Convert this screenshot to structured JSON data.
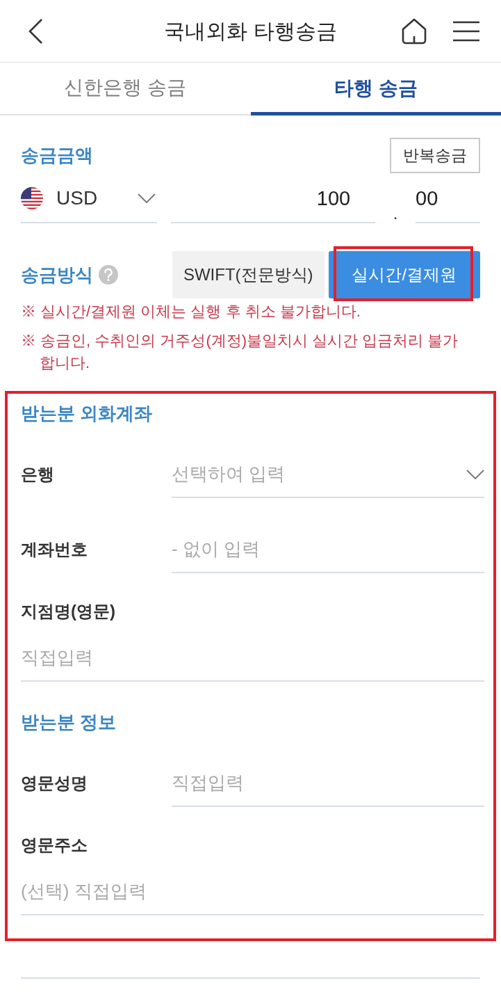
{
  "header": {
    "title": "국내외화 타행송금"
  },
  "tabs": [
    {
      "label": "신한은행 송금",
      "selected": false
    },
    {
      "label": "타행 송금",
      "selected": true
    }
  ],
  "amount": {
    "title": "송금금액",
    "repeat_button": "반복송금",
    "currency": "USD",
    "integer": "100",
    "separator": ".",
    "decimal": "00"
  },
  "method": {
    "title": "송금방식",
    "options": [
      {
        "label": "SWIFT(전문방식)",
        "selected": false,
        "highlighted": false
      },
      {
        "label": "실시간/결제원",
        "selected": true,
        "highlighted": true
      }
    ],
    "notices": [
      "※ 실시간/결제원 이체는 실행 후 취소 불가합니다.",
      "※ 송금인, 수취인의 거주성(계정)불일치시 실시간 입금처리 불가합니다."
    ]
  },
  "recipient": {
    "highlighted": true,
    "sections": [
      {
        "title": "받는분 외화계좌",
        "fields": [
          {
            "kind": "select",
            "label": "은행",
            "placeholder": "선택하여 입력"
          },
          {
            "kind": "inline",
            "label": "계좌번호",
            "placeholder": "- 없이 입력"
          },
          {
            "kind": "stacked",
            "label": "지점명(영문)",
            "placeholder": "직접입력"
          }
        ]
      },
      {
        "title": "받는분 정보",
        "fields": [
          {
            "kind": "inline",
            "label": "영문성명",
            "placeholder": "직접입력"
          },
          {
            "kind": "stacked",
            "label": "영문주소",
            "placeholder": "(선택) 직접입력"
          }
        ]
      }
    ]
  }
}
